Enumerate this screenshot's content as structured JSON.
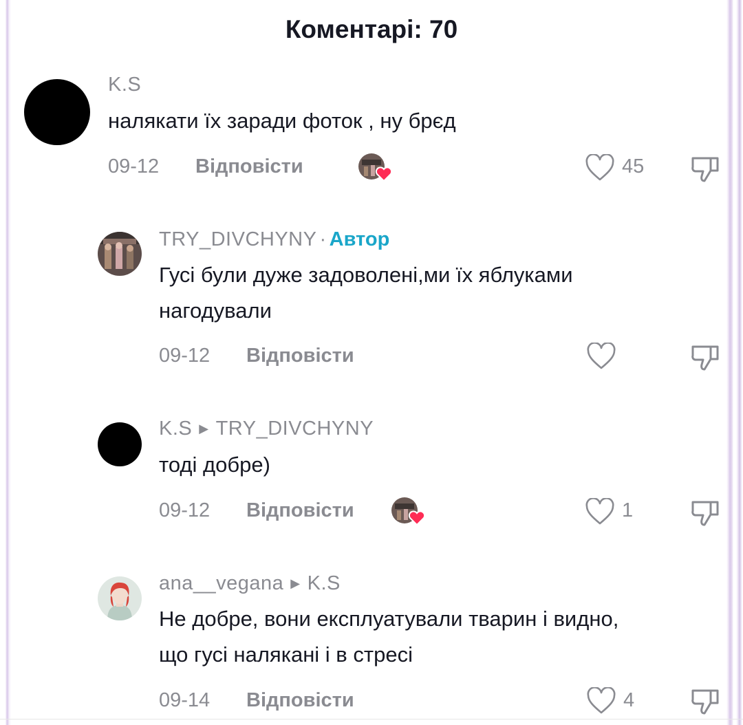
{
  "header": {
    "title": "Коментарі: 70"
  },
  "comments": [
    {
      "username": "K.S",
      "text": "налякати їх заради фоток , ну брєд",
      "date": "09-12",
      "reply_label": "Відповісти",
      "likes": "45",
      "author_liked": true
    },
    {
      "username": "TRY_DIVCHYNY",
      "separator": "·",
      "badge": "Автор",
      "text_lines": [
        "Гусі були дуже задоволені,ми їх яблуками",
        "нагодували"
      ],
      "date": "09-12",
      "reply_label": "Відповісти",
      "likes": ""
    },
    {
      "username": "K.S",
      "reply_to": "TRY_DIVCHYNY",
      "text": "тоді добре)",
      "date": "09-12",
      "reply_label": "Відповісти",
      "likes": "1",
      "author_liked": true
    },
    {
      "username": "ana__vegana",
      "reply_to": "K.S",
      "text_lines": [
        "Не добре, вони експлуатували тварин і видно,",
        "що гусі налякані і в стресі"
      ],
      "date": "09-14",
      "reply_label": "Відповісти",
      "likes": "4"
    }
  ],
  "colors": {
    "author_badge": "#1aa6c9",
    "liked_heart": "#fe2c55",
    "muted": "#8a8b91",
    "text": "#161823"
  },
  "icons": [
    "heart-outline-icon",
    "dislike-icon",
    "author-liked-heart-icon"
  ]
}
